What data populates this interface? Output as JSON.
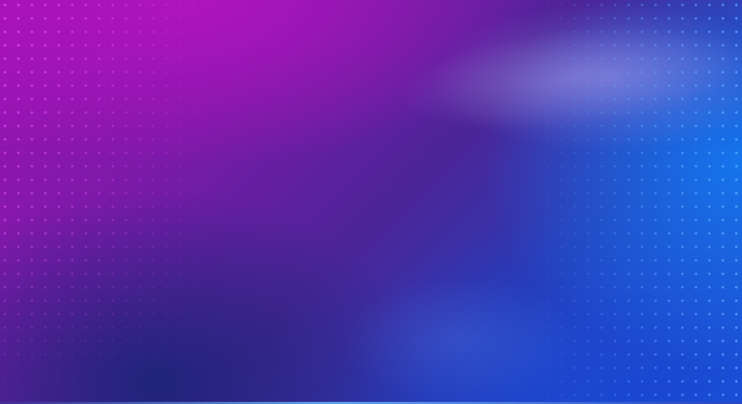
{
  "background": {
    "colors": {
      "magenta": "#a112b5",
      "purple": "#4c2598",
      "navy": "#1c2478",
      "blue": "#1b5be0",
      "dot_left": "#e650ff",
      "dot_right": "#5aaaff"
    },
    "elements": [
      "gradient-background",
      "dot-pattern-left",
      "dot-pattern-right"
    ]
  }
}
